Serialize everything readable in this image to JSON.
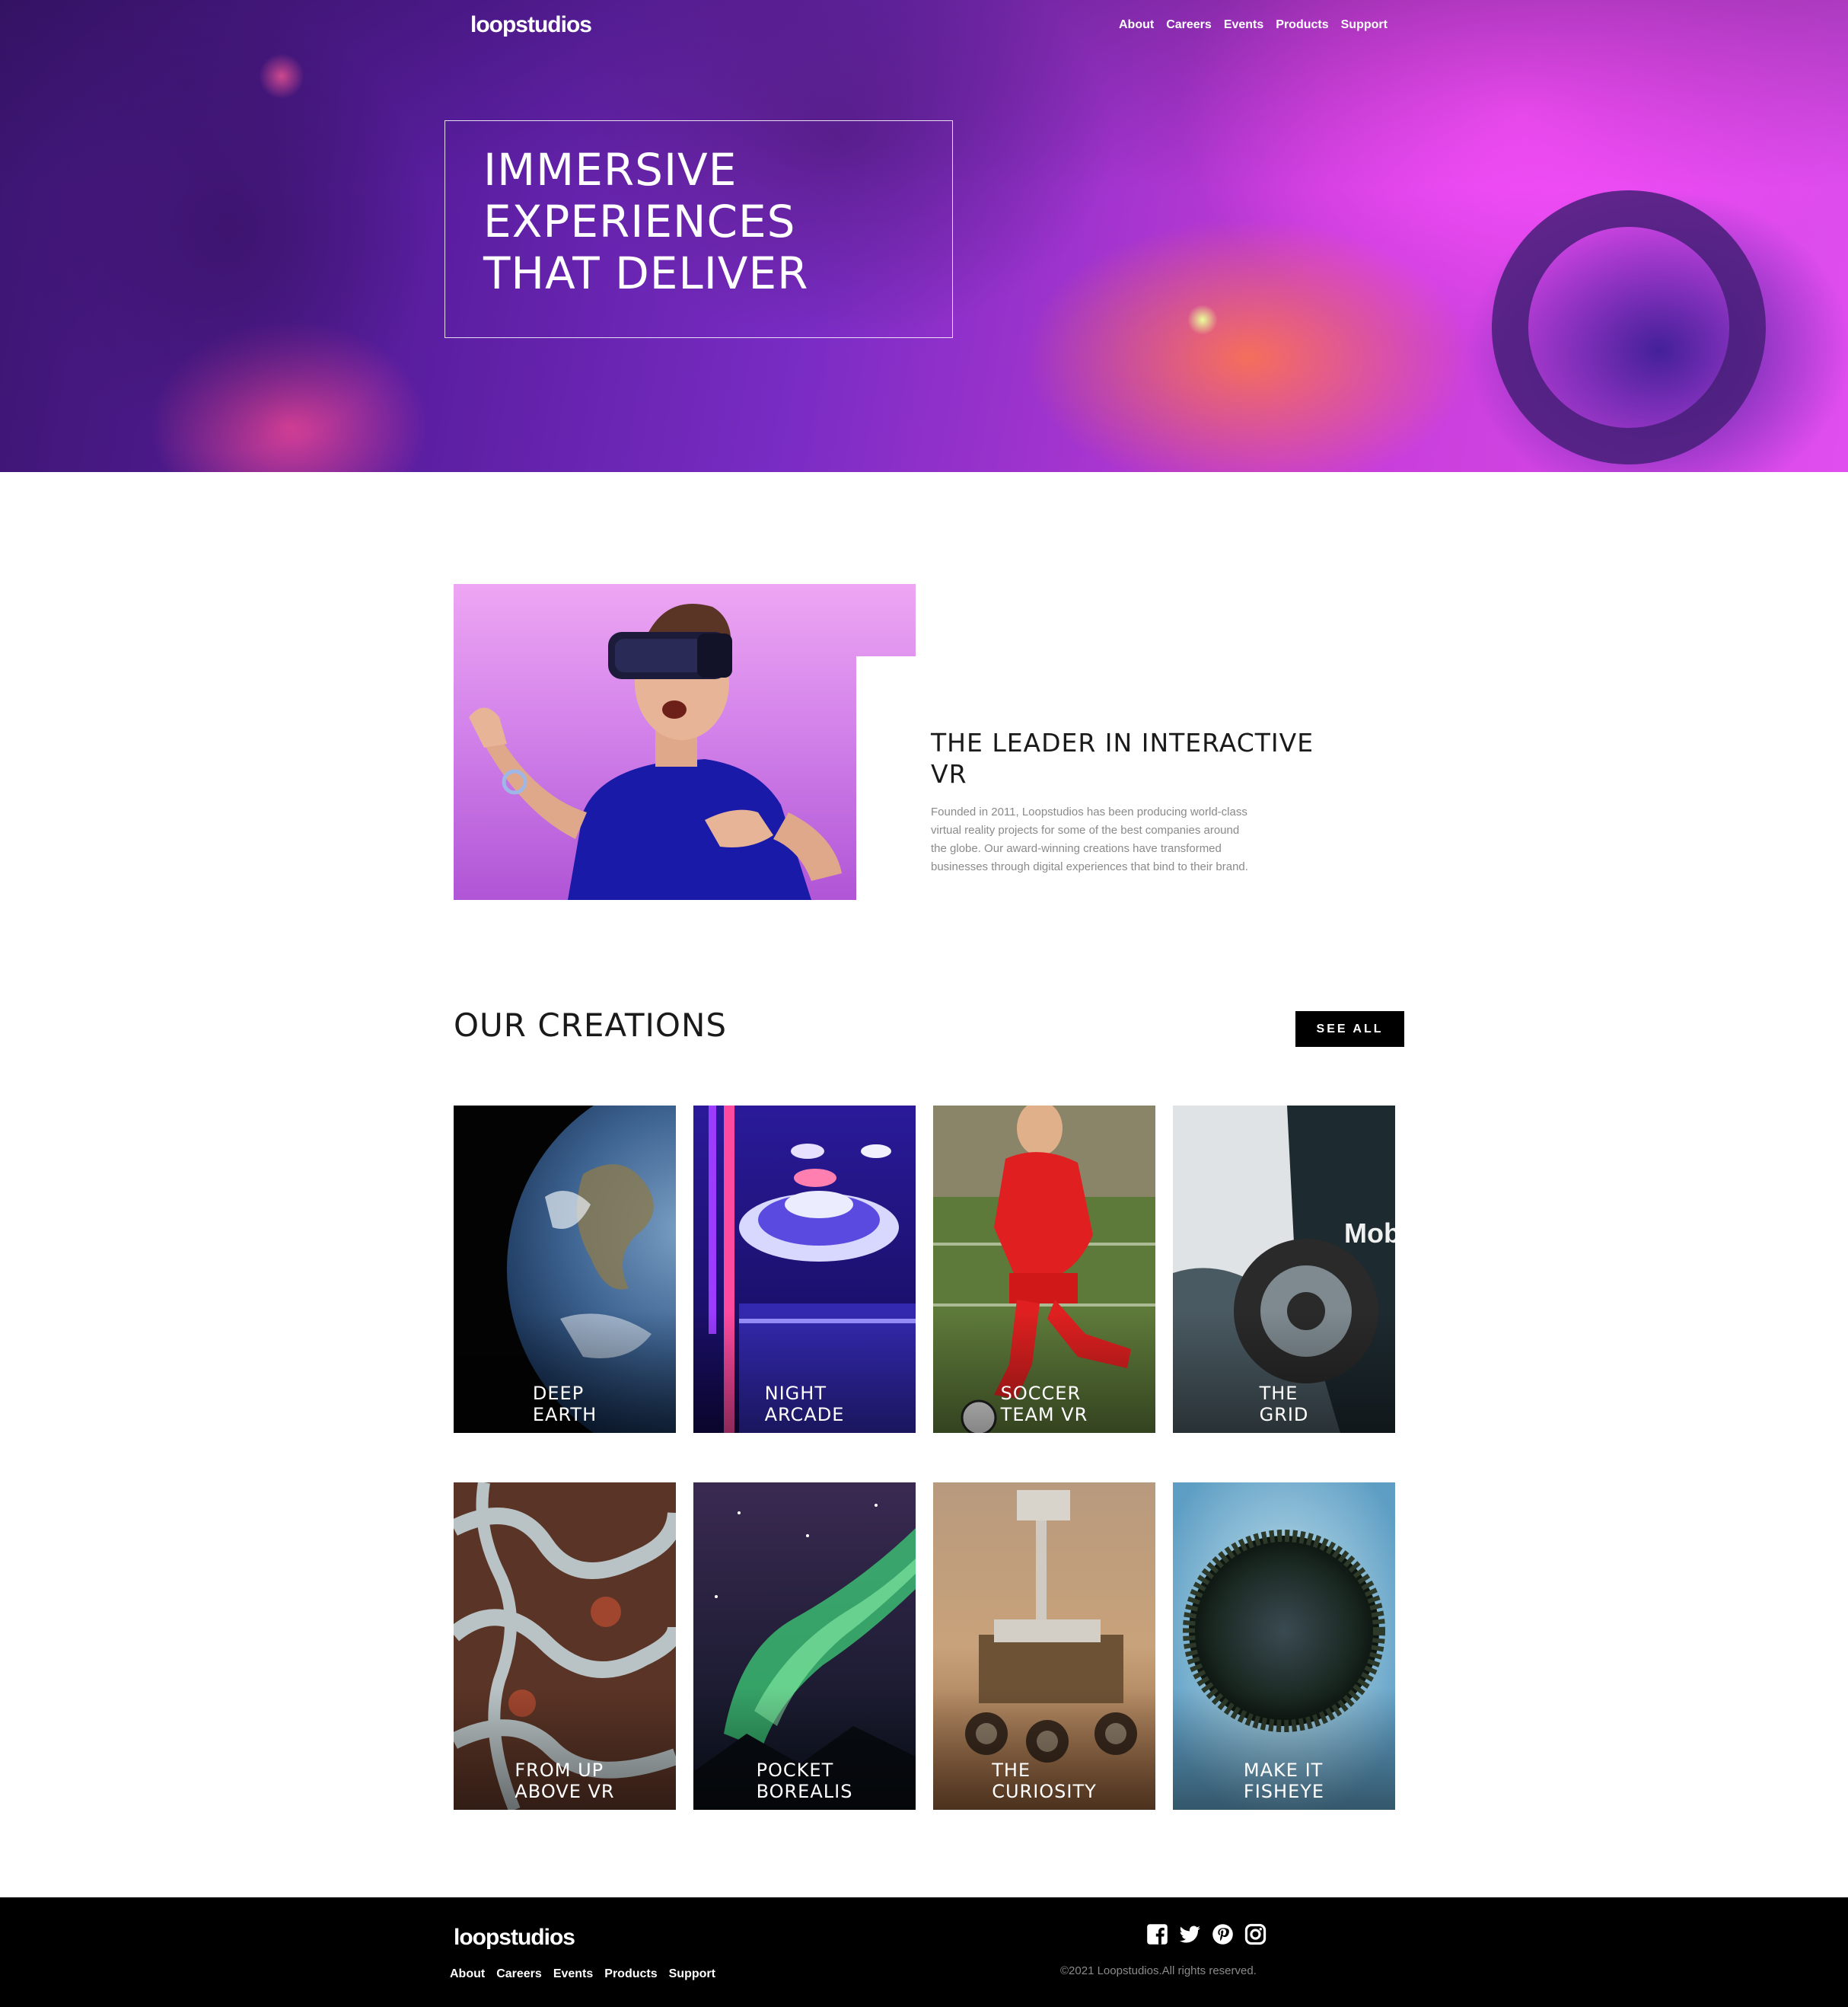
{
  "brand": {
    "logo": "loopstudios"
  },
  "nav": {
    "items": [
      "About",
      "Careers",
      "Events",
      "Products",
      "Support"
    ]
  },
  "hero": {
    "title": "IMMERSIVE EXPERIENCES THAT DELIVER"
  },
  "intro": {
    "title": "THE LEADER IN INTERACTIVE VR",
    "text": "Founded in 2011, Loopstudios has been producing world-class virtual reality projects for some of the best companies around the globe. Our award-winning creations have transformed businesses through digital experiences that bind to their brand."
  },
  "creations": {
    "title": "OUR CREATIONS",
    "see_all": "SEE ALL",
    "items": [
      {
        "l1": "DEEP",
        "l2": "EARTH"
      },
      {
        "l1": "NIGHT",
        "l2": "ARCADE"
      },
      {
        "l1": "SOCCER",
        "l2": "TEAM VR"
      },
      {
        "l1": "THE",
        "l2": "GRID"
      },
      {
        "l1": "FROM UP",
        "l2": "ABOVE VR"
      },
      {
        "l1": "POCKET",
        "l2": "BOREALIS"
      },
      {
        "l1": "THE",
        "l2": "CURIOSITY"
      },
      {
        "l1": "MAKE IT",
        "l2": "FISHEYE"
      }
    ]
  },
  "footer": {
    "logo": "loopstudios",
    "nav": [
      "About",
      "Careers",
      "Events",
      "Products",
      "Support"
    ],
    "social_icons": [
      "facebook-icon",
      "twitter-icon",
      "pinterest-icon",
      "instagram-icon"
    ],
    "copyright": "©2021 Loopstudios.All rights reserved."
  },
  "colors": {
    "footer_bg": "#000000",
    "button_bg": "#000000",
    "body_text": "#8a8a8a",
    "heading_text": "#1a1a1a"
  }
}
